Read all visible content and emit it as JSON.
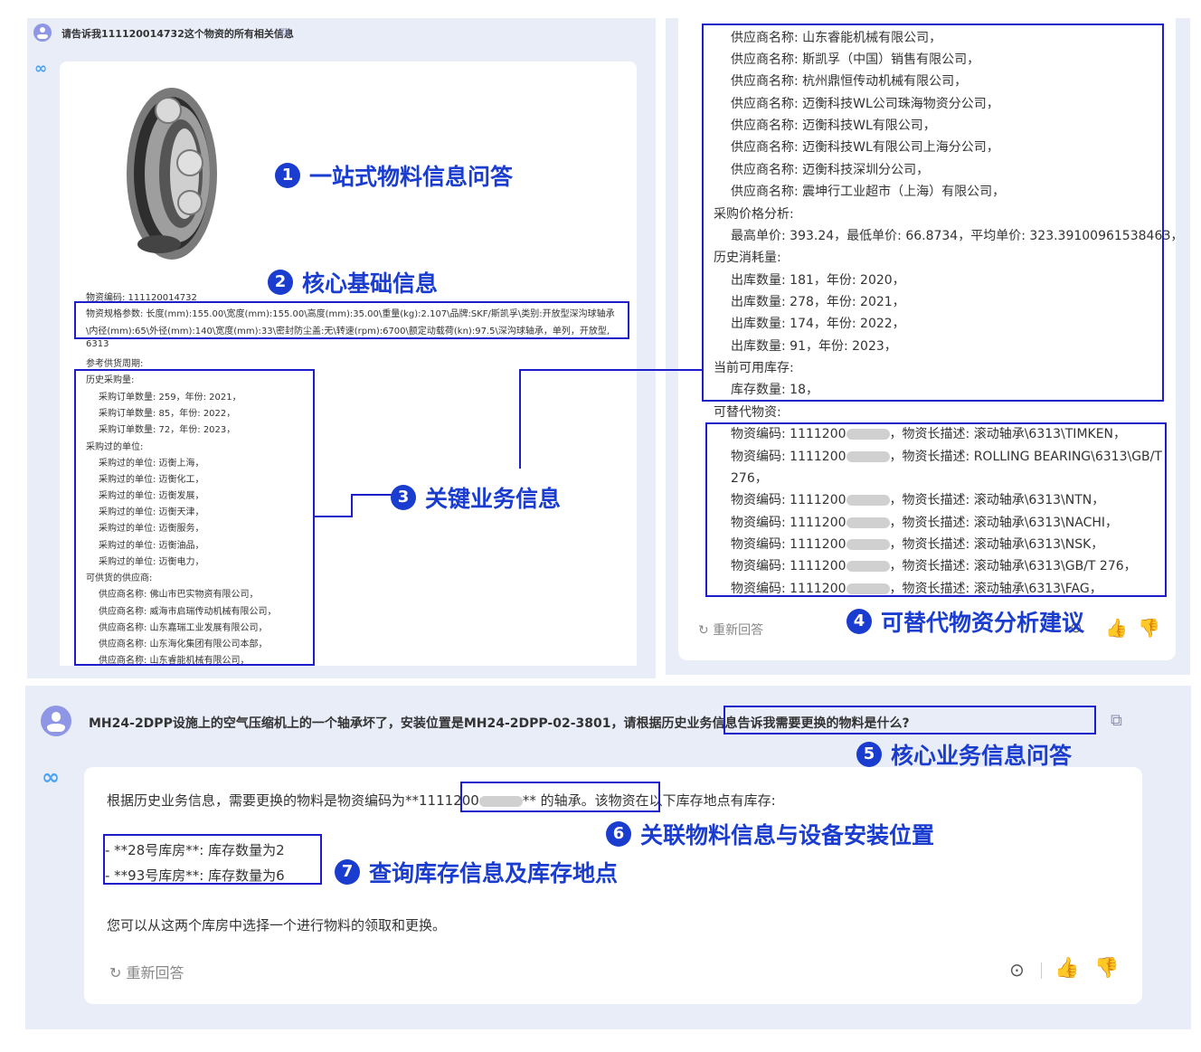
{
  "q1": {
    "text": "请告诉我111120014732这个物资的所有相关信息"
  },
  "left": {
    "code": "物资编码: 111120014732",
    "spec1": "物资规格参数: 长度(mm):155.00\\宽度(mm):155.00\\高度(mm):35.00\\重量(kg):2.107\\品牌:SKF/斯凯孚\\类别:开放型深沟球轴承",
    "spec2": "\\内径(mm):65\\外径(mm):140\\宽度(mm):33\\密封防尘盖:无\\转速(rpm):6700\\额定动载荷(kn):97.5\\深沟球轴承，单列，开放型,",
    "spec3": "6313",
    "period": "参考供货周期:",
    "hist_title": "历史采购量:",
    "hist": [
      "采购订单数量: 259，年份: 2021，",
      "采购订单数量: 85，年份: 2022，",
      "采购订单数量: 72，年份: 2023，"
    ],
    "units_title": "采购过的单位:",
    "units": [
      "采购过的单位: 迈衡上海，",
      "采购过的单位: 迈衡化工，",
      "采购过的单位: 迈衡发展，",
      "采购过的单位: 迈衡天津，",
      "采购过的单位: 迈衡服务，",
      "采购过的单位: 迈衡油品，",
      "采购过的单位: 迈衡电力，"
    ],
    "sup_title": "可供货的供应商:",
    "suppliers": [
      "供应商名称: 佛山市巴实物资有限公司，",
      "供应商名称: 威海市启瑞传动机械有限公司，",
      "供应商名称: 山东嘉瑞工业发展有限公司，",
      "供应商名称: 山东海化集团有限公司本部，",
      "供应商名称: 山东睿能机械有限公司，"
    ]
  },
  "right": {
    "suppliers": [
      "供应商名称: 山东睿能机械有限公司，",
      "供应商名称: 斯凯孚（中国）销售有限公司，",
      "供应商名称: 杭州鼎恒传动机械有限公司，",
      "供应商名称: 迈衡科技WL公司珠海物资分公司，",
      "供应商名称: 迈衡科技WL有限公司，",
      "供应商名称: 迈衡科技WL有限公司上海分公司，",
      "供应商名称: 迈衡科技深圳分公司，",
      "供应商名称: 震坤行工业超市（上海）有限公司，"
    ],
    "price_title": "采购价格分析:",
    "price": "最高单价: 393.24，最低单价: 66.8734，平均单价: 323.3910096153846З，",
    "usage_title": "历史消耗量:",
    "usage": [
      "出库数量: 181，年份: 2020，",
      "出库数量: 278，年份: 2021，",
      "出库数量: 174，年份: 2022，",
      "出库数量: 91，年份: 2023，"
    ],
    "stock_title": "当前可用库存:",
    "stock": "库存数量: 18，",
    "alt_title": "可替代物资:",
    "alt_prefix": "物资编码: 1111200",
    "alts": [
      "，物资长描述: 滚动轴承\\6313\\TIMKEN，",
      "，物资长描述: ROLLING BEARING\\6313\\GB/T",
      "，物资长描述: 滚动轴承\\6313\\NTN，",
      "，物资长描述: 滚动轴承\\6313\\NACHI，",
      "，物资长描述: 滚动轴承\\6313\\NSK，",
      "，物资长描述: 滚动轴承\\6313\\GB/T 276，",
      "，物资长描述: 滚动轴承\\6313\\FAG，"
    ],
    "alt_wrap": "276，",
    "regen": "重新回答"
  },
  "q2": {
    "prefix": "MH24-2DPP设施上的空气压缩机上的一个轴承坏了，安装位置是MH24-2DPP-02-3801，",
    "highlight": "请根据历史业务信息告诉我需要更换的物料是什么?"
  },
  "a2": {
    "line1_a": "根据历史业务信息，需要更换的物料是物资编码为",
    "line1_code": "**1111200",
    "line1_b": "** 的轴承",
    "line1_c": "。该物资在以下库存地点有库存:",
    "stock1": "- **28号库房**:  库存数量为2",
    "stock2": "- **93号库房**:  库存数量为6",
    "line3": "您可以从这两个库房中选择一个进行物料的领取和更换。",
    "regen": "重新回答"
  },
  "annotations": {
    "a1": {
      "num": "1",
      "text": "一站式物料信息问答"
    },
    "a2": {
      "num": "2",
      "text": "核心基础信息"
    },
    "a3": {
      "num": "3",
      "text": "关键业务信息"
    },
    "a4": {
      "num": "4",
      "text": "可替代物资分析建议"
    },
    "a5": {
      "num": "5",
      "text": "核心业务信息问答"
    },
    "a6": {
      "num": "6",
      "text": "关联物料信息与设备安装位置"
    },
    "a7": {
      "num": "7",
      "text": "查询库存信息及库存地点"
    }
  },
  "colors": {
    "annotation": "#1a3ccf",
    "box": "#1d1dc9",
    "panel": "#e9edf8",
    "avatar": "#8f96e6",
    "logo": "#4aa3f0"
  }
}
